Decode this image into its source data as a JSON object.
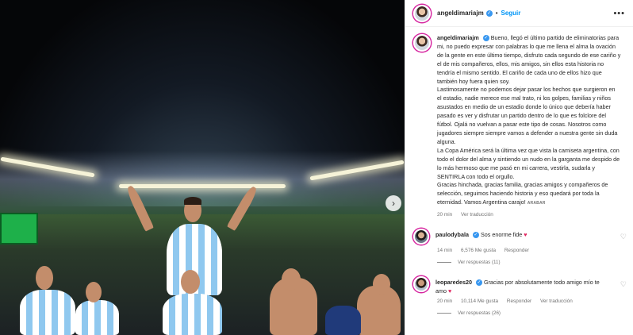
{
  "post": {
    "username": "angeldimariajm",
    "follow_label": "Seguir",
    "more_label": "•••",
    "separator": "•",
    "verified_mark": "✓",
    "carousel_next": "›",
    "caption_lines": [
      "Bueno, llegó el último partido de eliminatorias para mi, no puedo expresar con palabras lo que me llena el alma la ovación de la gente en este último tiempo, disfruto cada segundo de ese cariño y el de mis compañeros, ellos, mis amigos, sin ellos esta historia no tendría el mismo sentido. El cariño de cada uno de ellos hizo que también hoy fuera quien soy.",
      "Lastimosamente no podemos dejar pasar los hechos que surgieron en el estadio, nadie merece ese mal trato, ni los golpes, familias y niños asustados en medio de un estadio donde lo único que debería haber pasado es ver y disfrutar un partido dentro de lo que es folclore del fútbol. Ojalá no vuelvan a pasar este tipo de cosas. Nosotros como jugadores siempre siempre vamos a defender a nuestra gente sin duda alguna.",
      "La Copa América será la última vez que vista la camiseta argentina, con todo el dolor del alma y sintiendo un nudo en la garganta me despido de lo más hermoso que me pasó en mi carrera, vestirla, sudarla y SENTIRLA con todo el orgullo.",
      "Gracias hinchada, gracias familia, gracias amigos y compañeros de selección, seguimos haciendo historia y eso quedará por toda la eternidad. Vamos Argentina carajo!"
    ],
    "caption_flag": "ARABAR",
    "time": "20 min",
    "see_translation": "Ver traducción"
  },
  "comments": [
    {
      "username": "paulodybala",
      "text": "Sos enorme fide",
      "emoji": "♥",
      "time": "14 min",
      "likes": "6,576 Me gusta",
      "reply": "Responder",
      "see_translation": "",
      "replies": "Ver respuestas (11)"
    },
    {
      "username": "leoparedes20",
      "text": "Gracias por absolutamente todo amigo mío te amo",
      "emoji": "♥",
      "time": "20 min",
      "likes": "10,114 Me gusta",
      "reply": "Responder",
      "see_translation": "Ver traducción",
      "replies": "Ver respuestas (26)"
    }
  ],
  "icons": {
    "like": "heart-outline-icon",
    "verified": "verified-badge-icon",
    "more": "more-options-icon"
  },
  "colors": {
    "follow": "#0095f6",
    "verified": "#3897f0",
    "heart": "#e0245e",
    "photo_bg": "#0a0d14"
  }
}
